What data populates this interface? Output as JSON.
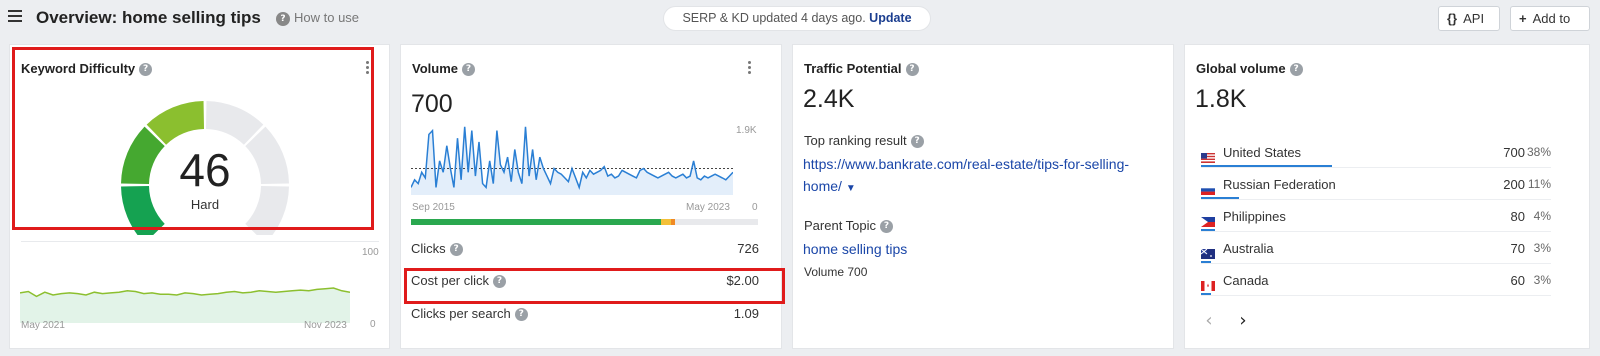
{
  "header": {
    "title": "Overview: home selling tips",
    "how_to_use": "How to use",
    "status_text": "SERP & KD updated 4 days ago.",
    "update_link": "Update",
    "api_label": "API",
    "api_glyph": "{}",
    "add_to_label": "Add to"
  },
  "kd": {
    "title": "Keyword Difficulty",
    "value": "46",
    "label": "Hard",
    "gauge_level": 46,
    "gauge_colors": [
      "#15a251",
      "#45a830",
      "#8bbf2f",
      "#c8c41a"
    ],
    "gauge_empty_color": "#e8e9ec",
    "trend_max": "100",
    "trend_min": "0",
    "trend_start": "May 2021",
    "trend_end": "Nov 2023",
    "trend_color": "#8cbf2f"
  },
  "volume": {
    "title": "Volume",
    "value": "700",
    "chart_max": "1.9K",
    "chart_min": "0",
    "chart_start": "Sep 2015",
    "chart_end": "May 2023",
    "line_color": "#2a7fd4",
    "intent_bar": [
      {
        "color": "#2aa84f",
        "fraction": 0.72
      },
      {
        "color": "#f3c038",
        "fraction": 0.03
      },
      {
        "color": "#f08a24",
        "fraction": 0.01
      },
      {
        "color": "#e8e9ec",
        "fraction": 0.24
      }
    ],
    "clicks_label": "Clicks",
    "clicks_value": "726",
    "cpc_label": "Cost per click",
    "cpc_value": "$2.00",
    "cps_label": "Clicks per search",
    "cps_value": "1.09"
  },
  "traffic": {
    "title": "Traffic Potential",
    "value": "2.4K",
    "top_result_label": "Top ranking result",
    "top_result_url_line1": "https://www.bankrate.com/real-estate/tips-for-selling-",
    "top_result_url_line2": "home/",
    "parent_topic_label": "Parent Topic",
    "parent_topic_link": "home selling tips",
    "parent_volume": "Volume 700"
  },
  "global": {
    "title": "Global volume",
    "value": "1.8K",
    "countries": [
      {
        "name": "United States",
        "volume": "700",
        "pct": "38%",
        "share": 0.38,
        "flag": "us"
      },
      {
        "name": "Russian Federation",
        "volume": "200",
        "pct": "11%",
        "share": 0.11,
        "flag": "ru"
      },
      {
        "name": "Philippines",
        "volume": "80",
        "pct": "4%",
        "share": 0.04,
        "flag": "ph"
      },
      {
        "name": "Australia",
        "volume": "70",
        "pct": "3%",
        "share": 0.03,
        "flag": "au"
      },
      {
        "name": "Canada",
        "volume": "60",
        "pct": "3%",
        "share": 0.03,
        "flag": "ca"
      }
    ]
  },
  "chart_data": [
    {
      "type": "area",
      "ylim": [
        0,
        100
      ],
      "x": [
        "May 2021",
        "Nov 2023"
      ],
      "series": [
        {
          "values": [
            43,
            45,
            38,
            44,
            40,
            42,
            43,
            42,
            40,
            44,
            42,
            43,
            44,
            46,
            45,
            42,
            43,
            41,
            41,
            40,
            43,
            42,
            40,
            41,
            42,
            44,
            45,
            43,
            44,
            46,
            45,
            44,
            45,
            46,
            47,
            46,
            48,
            49,
            50,
            46,
            44
          ]
        }
      ]
    },
    {
      "type": "area",
      "ylim": [
        0,
        1900
      ],
      "x": [
        "Sep 2015",
        "May 2023"
      ],
      "series": [
        {
          "values": [
            200,
            400,
            300,
            600,
            450,
            1600,
            1700,
            200,
            900,
            600,
            1300,
            700,
            200,
            1500,
            400,
            1800,
            600,
            1700,
            500,
            1400,
            300,
            200,
            900,
            300,
            1700,
            800,
            600,
            1000,
            350,
            1200,
            600,
            300,
            1800,
            500,
            1200,
            400,
            1000,
            700,
            500,
            300,
            700,
            600,
            550,
            450,
            350,
            700,
            450,
            200,
            600,
            450,
            650,
            550,
            600,
            650,
            750,
            500,
            550,
            450,
            500,
            650,
            600,
            550,
            500,
            450,
            650,
            700,
            600,
            550,
            500,
            450,
            500,
            550,
            600,
            500,
            450,
            500,
            550,
            450,
            500,
            900,
            450,
            400,
            500,
            450,
            500,
            550,
            500,
            450,
            400,
            500,
            600
          ]
        }
      ],
      "reference_level": 700
    }
  ]
}
